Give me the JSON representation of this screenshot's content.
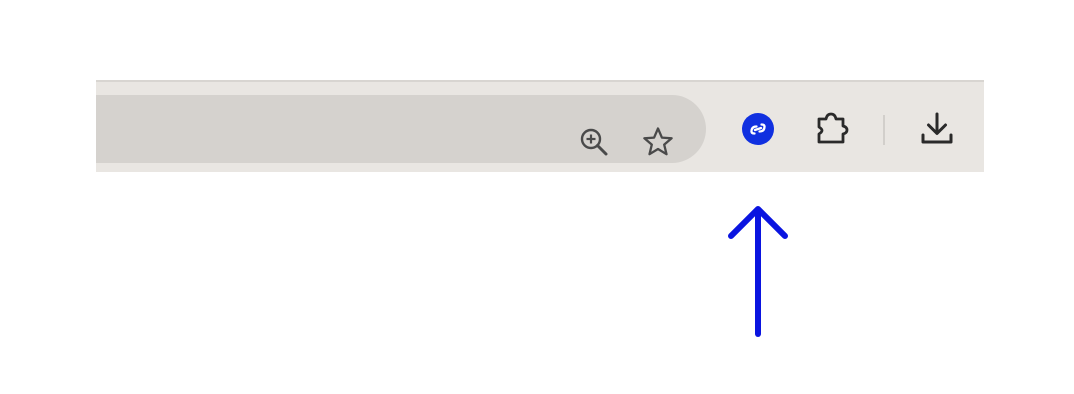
{
  "toolbar": {
    "omnibox": {
      "zoom_icon": "zoom-in-icon",
      "bookmark_icon": "star-outline-icon"
    },
    "extension_icon": "blue-circle-link-extension-icon",
    "extensions_menu_icon": "puzzle-piece-icon",
    "download_icon": "download-icon"
  },
  "annotation": {
    "pointer": "up-arrow",
    "color": "#0a14e0"
  },
  "colors": {
    "toolbar_bg": "#e9e6e2",
    "omnibox_bg": "#d5d2ce",
    "extension_blue": "#1030e0"
  }
}
